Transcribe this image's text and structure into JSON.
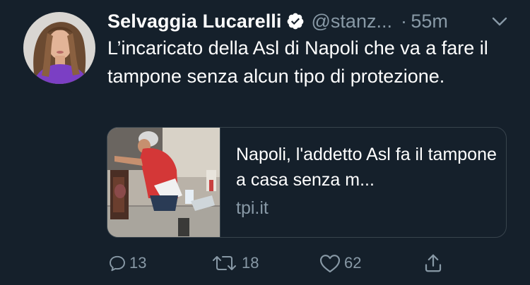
{
  "author": {
    "name": "Selvaggia Lucarelli",
    "handle": "@stanz...",
    "time": "55m",
    "separator": "·",
    "verified": true
  },
  "tweet": {
    "text": "L’incaricato della Asl di Napoli che va a fare il tampone senza alcun tipo di protezione."
  },
  "card": {
    "title": "Napoli, l'addetto Asl fa il tampone a casa senza m...",
    "domain": "tpi.it"
  },
  "actions": {
    "reply_count": "13",
    "retweet_count": "18",
    "like_count": "62"
  },
  "colors": {
    "background": "#15202b",
    "text": "#ffffff",
    "muted": "#8899a6",
    "border": "#38444d",
    "verified": "#ffffff"
  },
  "icons": [
    "verified-icon",
    "chevron-down-icon",
    "reply-icon",
    "retweet-icon",
    "like-icon",
    "share-icon"
  ]
}
